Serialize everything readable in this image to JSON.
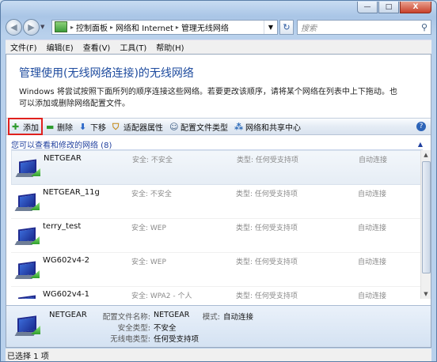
{
  "window": {
    "minimize": "—",
    "maximize": "□",
    "close": "X"
  },
  "nav": {
    "breadcrumbs": [
      "控制面板",
      "网络和 Internet",
      "管理无线网络"
    ],
    "search_placeholder": "搜索"
  },
  "menu": [
    "文件(F)",
    "编辑(E)",
    "查看(V)",
    "工具(T)",
    "帮助(H)"
  ],
  "page": {
    "heading": "管理使用(无线网络连接)的无线网络",
    "description": "Windows 将尝试按照下面所列的顺序连接这些网络。若要更改该顺序，请将某个网络在列表中上下拖动。也可以添加或删除网络配置文件。"
  },
  "toolbar": {
    "add": "添加",
    "remove": "删除",
    "move_down": "下移",
    "adapter": "适配器属性",
    "profile_type": "配置文件类型",
    "network_center": "网络和共享中心",
    "help": "?"
  },
  "group": {
    "label": "您可以查看和修改的网络 (8)"
  },
  "networks": [
    {
      "name": "NETGEAR",
      "security": "安全: 不安全",
      "type": "类型: 任何受支持项",
      "mode": "自动连接"
    },
    {
      "name": "NETGEAR_11g",
      "security": "安全: 不安全",
      "type": "类型: 任何受支持项",
      "mode": "自动连接"
    },
    {
      "name": "terry_test",
      "security": "安全: WEP",
      "type": "类型: 任何受支持项",
      "mode": "自动连接"
    },
    {
      "name": "WG602v4-2",
      "security": "安全: WEP",
      "type": "类型: 任何受支持项",
      "mode": "自动连接"
    },
    {
      "name": "WG602v4-1",
      "security": "安全: WPA2 - 个人",
      "type": "类型: 任何受支持项",
      "mode": "自动连接"
    }
  ],
  "details": {
    "name": "NETGEAR",
    "profile_label": "配置文件名称:",
    "profile_value": "NETGEAR",
    "mode_label": "模式:",
    "mode_value": "自动连接",
    "security_label": "安全类型:",
    "security_value": "不安全",
    "radio_label": "无线电类型:",
    "radio_value": "任何受支持项"
  },
  "status": {
    "text": "已选择 1 项"
  }
}
